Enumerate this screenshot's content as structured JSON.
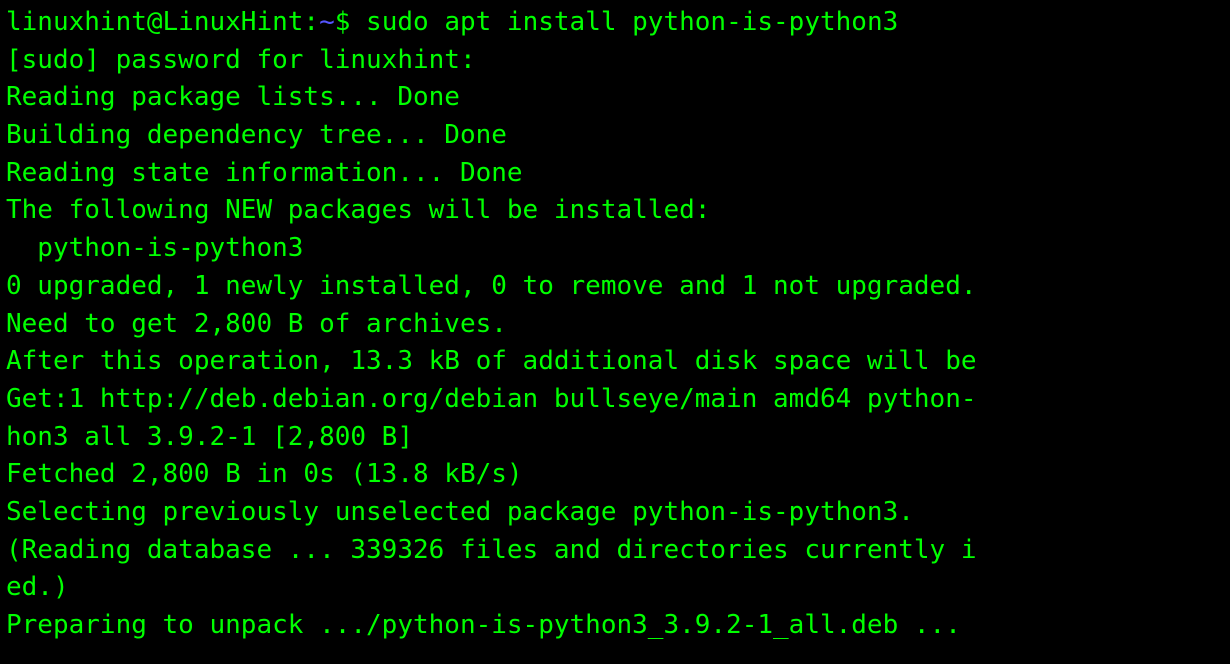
{
  "prompt": {
    "userhost": "linuxhint@LinuxHint",
    "separator": ":",
    "path": "~",
    "symbol": "$ ",
    "command": "sudo apt install python-is-python3"
  },
  "output": {
    "line1": "[sudo] password for linuxhint:",
    "line2": "Reading package lists... Done",
    "line3": "Building dependency tree... Done",
    "line4": "Reading state information... Done",
    "line5": "The following NEW packages will be installed:",
    "line6": "  python-is-python3",
    "line7": "0 upgraded, 1 newly installed, 0 to remove and 1 not upgraded.",
    "line8": "Need to get 2,800 B of archives.",
    "line9": "After this operation, 13.3 kB of additional disk space will be",
    "line10": "Get:1 http://deb.debian.org/debian bullseye/main amd64 python-",
    "line11": "hon3 all 3.9.2-1 [2,800 B]",
    "line12": "Fetched 2,800 B in 0s (13.8 kB/s)",
    "line13": "Selecting previously unselected package python-is-python3.",
    "line14": "(Reading database ... 339326 files and directories currently i",
    "line15": "ed.)",
    "line16": "Preparing to unpack .../python-is-python3_3.9.2-1_all.deb ..."
  }
}
